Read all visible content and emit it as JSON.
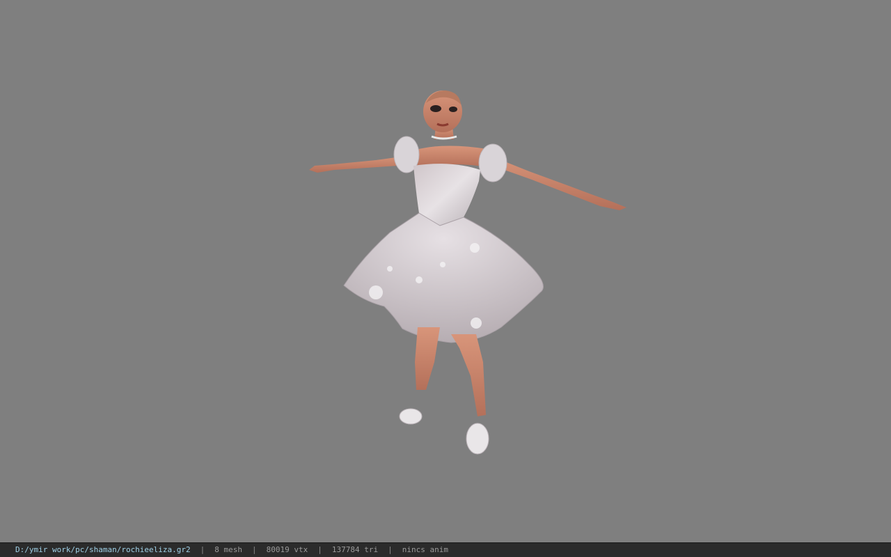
{
  "viewport": {
    "background": "#7f7f7f",
    "subject": "character-model"
  },
  "status": {
    "path": "D:/ymir work/pc/shaman/rochieeliza.gr2",
    "separator": "|",
    "mesh": "8 mesh",
    "vtx": "80019 vtx",
    "tri": "137784 tri",
    "anim": "nincs anim"
  }
}
